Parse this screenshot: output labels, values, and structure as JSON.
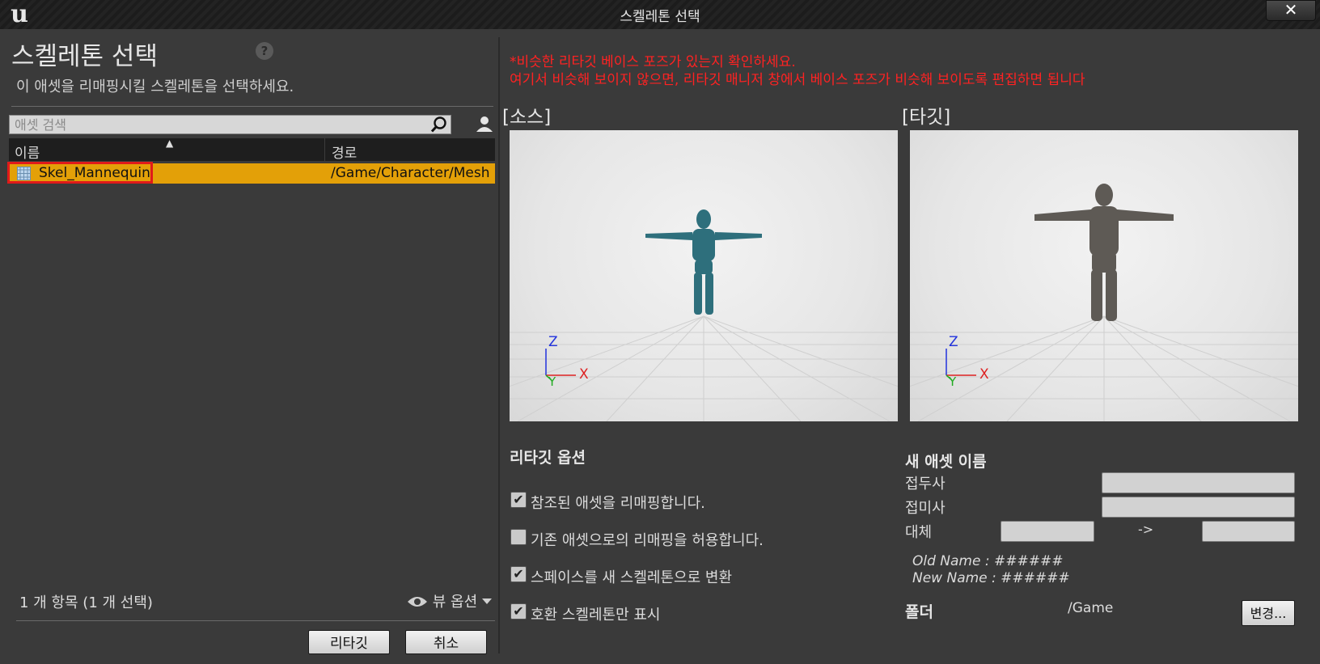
{
  "window": {
    "title": "스켈레톤 선택",
    "logo": "u",
    "close_glyph": "✕"
  },
  "left_panel": {
    "heading": "스켈레톤 선택",
    "help_glyph": "?",
    "subtitle": "이 애셋을 리매핑시킬 스켈레톤을 선택하세요.",
    "search": {
      "placeholder": "애셋 검색",
      "value": ""
    },
    "columns": {
      "name": "이름",
      "path": "경로",
      "sort_glyph": "▲"
    },
    "rows": [
      {
        "name": "Skel_Mannequin",
        "path": "/Game/Character/Mesh",
        "selected": true
      }
    ],
    "item_count": "1 개 항목 (1 개 선택)",
    "view_options": "뷰 옵션",
    "buttons": {
      "retarget": "리타깃",
      "cancel": "취소"
    }
  },
  "right_panel": {
    "notice_line1": "*비슷한 리타깃 베이스 포즈가 있는지 확인하세요.",
    "notice_line2": "여기서 비슷해 보이지 않으면, 리타깃 매니저 창에서 베이스 포즈가 비슷해 보이도록 편집하면 됩니다",
    "source_label": "[소스]",
    "target_label": "[타깃]",
    "axes": {
      "z": "Z",
      "x": "X",
      "y": "Y"
    },
    "retarget_options": {
      "title": "리타깃 옵션",
      "items": [
        {
          "label": "참조된 애셋을 리매핑합니다.",
          "checked": true
        },
        {
          "label": "기존 애셋으로의 리매핑을 허용합니다.",
          "checked": false
        },
        {
          "label": "스페이스를 새 스켈레톤으로 변환",
          "checked": true
        },
        {
          "label": "호환 스켈레톤만 표시",
          "checked": true
        }
      ]
    },
    "new_asset_name": {
      "title": "새 애셋 이름",
      "prefix_label": "접두사",
      "prefix_value": "",
      "suffix_label": "접미사",
      "suffix_value": "",
      "replace_label": "대체",
      "replace_from": "",
      "replace_arrow": "->",
      "replace_to": "",
      "old_name": "Old Name : ######",
      "new_name": "New Name : ######"
    },
    "folder": {
      "label": "폴더",
      "value": "/Game",
      "change_button": "변경..."
    }
  },
  "colors": {
    "selection": "#e3a008",
    "highlight_border": "#e01a1a",
    "notice": "#ff2222",
    "source_mannequin": "#2e6f7c",
    "target_mannequin": "#5e5a55"
  }
}
